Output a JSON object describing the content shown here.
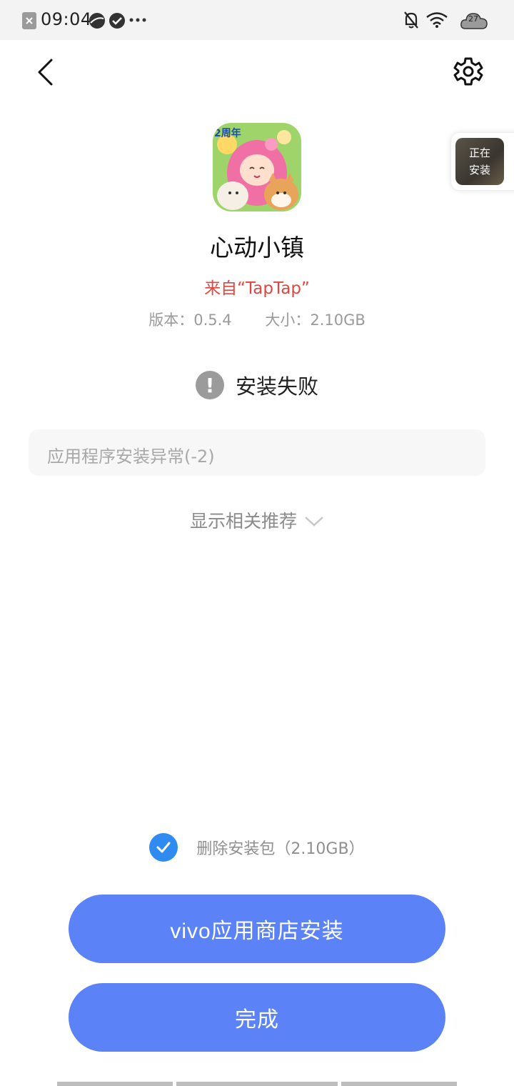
{
  "status_bar": {
    "time": "09:04",
    "weather_temp": "27",
    "icons": [
      "app-notification-icon",
      "browser-icon",
      "check-icon",
      "more-dots-icon",
      "bell-off-icon",
      "wifi-icon",
      "cloud-weather-icon"
    ]
  },
  "floating_widget": {
    "line1": "正在",
    "line2": "安装"
  },
  "app": {
    "name": "心动小镇",
    "source": "来自“TapTap”",
    "version": "版本：0.5.4",
    "size": "大小：2.10GB",
    "icon_badge": "2周年"
  },
  "install": {
    "status": "安装失败",
    "status_icon": "!",
    "error": "应用程序安装异常(-2)"
  },
  "recommend": {
    "label": "显示相关推荐"
  },
  "options": {
    "delete_package": "删除安装包（2.10GB）",
    "delete_checked": true
  },
  "buttons": {
    "store_install": "vivo应用商店安装",
    "done": "完成"
  },
  "colors": {
    "accent": "#5b82f7",
    "error": "#e0463f",
    "checkbox": "#2f8bf0"
  }
}
